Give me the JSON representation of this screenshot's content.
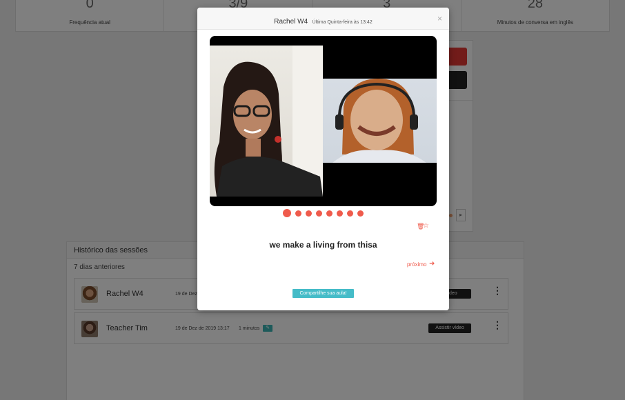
{
  "stats": [
    {
      "value": "0",
      "label": "Frequência atual"
    },
    {
      "value": "3/9",
      "label": ""
    },
    {
      "value": "3",
      "label": ""
    },
    {
      "value": "28",
      "label": "Minutos de conversa em inglês"
    }
  ],
  "history": {
    "title": "Histórico das sessões",
    "subtitle": "7 dias anteriores",
    "sessions": [
      {
        "name": "Rachel W4",
        "date": "19 de Dez",
        "duration": "",
        "watch": "r vídeo"
      },
      {
        "name": "Teacher Tim",
        "date": "19 de Dez de 2019 13:17",
        "duration": "1 minutos",
        "watch": "Assistir vídeo"
      }
    ]
  },
  "modal": {
    "name": "Rachel W4",
    "time": "Última Quinta-feira às 13:42",
    "close": "×",
    "phrase": "we make a living from thisa",
    "next": "próximo",
    "share": "Compartilhe sua aula!",
    "slides": 8,
    "active_slide": 1
  },
  "icons": {
    "close": "close-icon",
    "delete": "trash-icon",
    "favorite": "star-icon",
    "next": "arrow-right-icon",
    "menu": "kebab-menu-icon",
    "edit": "pencil-icon"
  },
  "colors": {
    "accent": "#ef5b4c",
    "share_button": "#45bcc8",
    "watch_button": "#222222",
    "edit_button": "#3bb5b5"
  }
}
